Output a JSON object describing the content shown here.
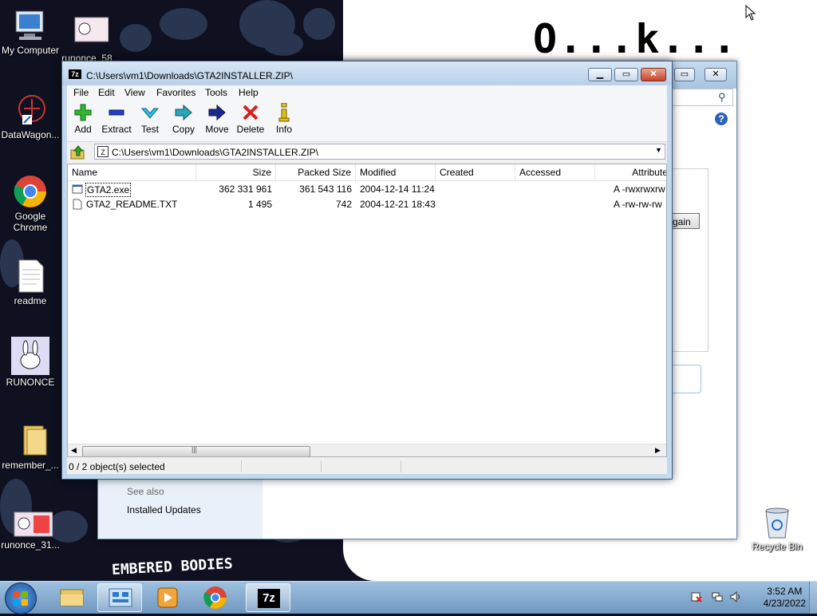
{
  "desktop": {
    "icons": [
      {
        "label": "My Computer"
      },
      {
        "label": "runonce_58..."
      },
      {
        "label": "DataWagon..."
      },
      {
        "label": "Google Chrome"
      },
      {
        "label": "readme"
      },
      {
        "label": "RUNONCE"
      },
      {
        "label": "remember_..."
      },
      {
        "label": "runonce_31..."
      },
      {
        "label": "Recycle Bin"
      }
    ],
    "wallpaper_text": "O...k...",
    "wallpaper_deco": "EMBERED BODIES"
  },
  "background_window": {
    "see_also": "See also",
    "installed_updates": "Installed Updates",
    "button_partial": "gain"
  },
  "window": {
    "title": "C:\\Users\\vm1\\Downloads\\GTA2INSTALLER.ZIP\\",
    "app_icon": "7z",
    "menu": [
      "File",
      "Edit",
      "View",
      "Favorites",
      "Tools",
      "Help"
    ],
    "toolbar": {
      "add": "Add",
      "extract": "Extract",
      "test": "Test",
      "copy": "Copy",
      "move": "Move",
      "delete": "Delete",
      "info": "Info"
    },
    "address": "C:\\Users\\vm1\\Downloads\\GTA2INSTALLER.ZIP\\",
    "columns": {
      "name": "Name",
      "size": "Size",
      "packed": "Packed Size",
      "modified": "Modified",
      "created": "Created",
      "accessed": "Accessed",
      "attributes": "Attribute"
    },
    "files": [
      {
        "name": "GTA2.exe",
        "size": "362 331 961",
        "packed": "361 543 116",
        "modified": "2004-12-14 11:24",
        "attributes": "A -rwxrwxrw"
      },
      {
        "name": "GTA2_README.TXT",
        "size": "1 495",
        "packed": "742",
        "modified": "2004-12-21 18:43",
        "attributes": "A -rw-rw-rw"
      }
    ],
    "status": "0 / 2 object(s) selected"
  },
  "taskbar": {
    "time": "3:52 AM",
    "date": "4/23/2022",
    "active_app": "7z"
  },
  "colors": {
    "taskbar": "#7fa6cc",
    "accent": "#3a5a80"
  }
}
